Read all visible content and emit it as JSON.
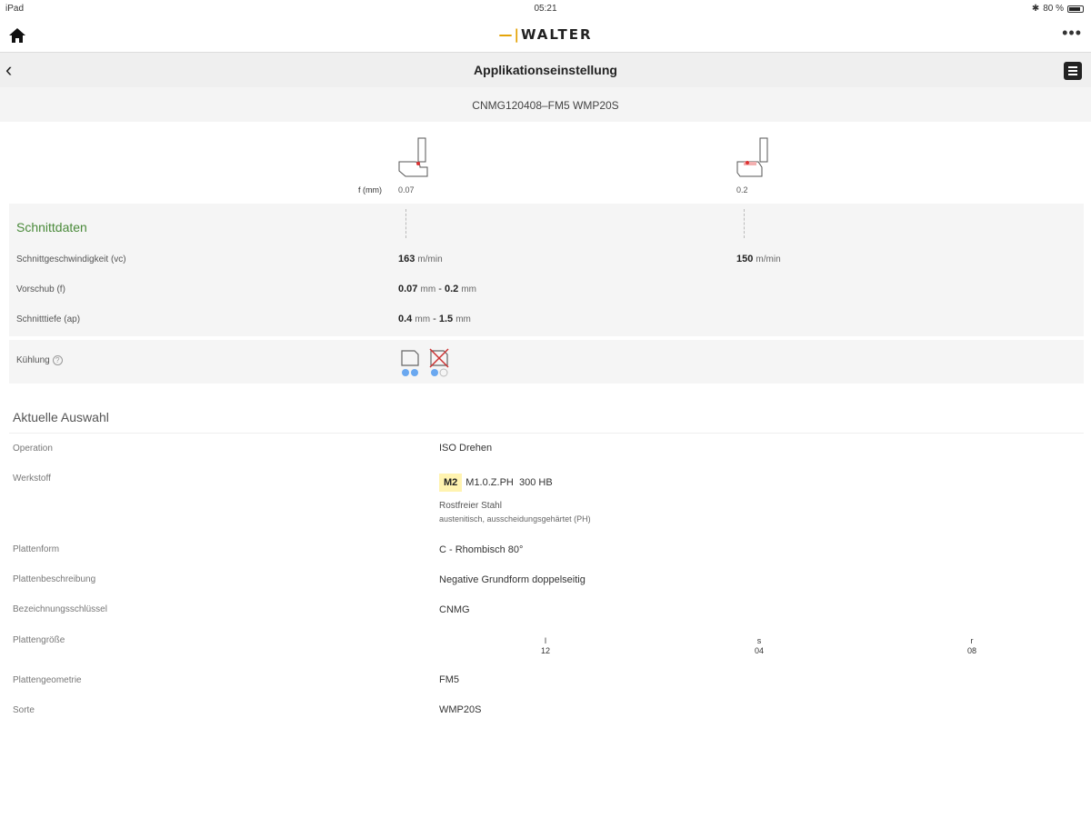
{
  "status": {
    "device": "iPad",
    "time": "05:21",
    "battery": "80 %"
  },
  "header": {
    "logo": "WALTER",
    "more": "•••"
  },
  "nav": {
    "title": "Applikationseinstellung"
  },
  "product": {
    "code": "CNMG120408–FM5 WMP20S"
  },
  "feed_header": {
    "label": "f (mm)",
    "values": [
      "0.07",
      "0.2"
    ]
  },
  "cutting": {
    "title": "Schnittdaten",
    "speed": {
      "label": "Schnittgeschwindigkeit (vc)",
      "v1": "163",
      "v2": "150",
      "unit": "m/min"
    },
    "feed": {
      "label": "Vorschub (f)",
      "from": "0.07",
      "to": "0.2",
      "unit": "mm",
      "sep": "-"
    },
    "depth": {
      "label": "Schnitttiefe (ap)",
      "from": "0.4",
      "to": "1.5",
      "unit": "mm",
      "sep": "-"
    },
    "cooling": {
      "label": "Kühlung",
      "help": "?"
    }
  },
  "selection": {
    "title": "Aktuelle Auswahl",
    "operation": {
      "label": "Operation",
      "value": "ISO Drehen"
    },
    "material": {
      "label": "Werkstoff",
      "badge": "M2",
      "code": "M1.0.Z.PH",
      "hardness": "300 HB",
      "name": "Rostfreier Stahl",
      "desc": "austenitisch, ausscheidungsgehärtet (PH)"
    },
    "shape": {
      "label": "Plattenform",
      "value": "C - Rhombisch 80°"
    },
    "description": {
      "label": "Plattenbeschreibung",
      "value": "Negative Grundform doppelseitig"
    },
    "key": {
      "label": "Bezeichnungsschlüssel",
      "value": "CNMG"
    },
    "size": {
      "label": "Plattengröße",
      "cols": [
        {
          "h": "l",
          "v": "12"
        },
        {
          "h": "s",
          "v": "04"
        },
        {
          "h": "r",
          "v": "08"
        }
      ]
    },
    "geometry": {
      "label": "Plattengeometrie",
      "value": "FM5"
    },
    "grade": {
      "label": "Sorte",
      "value": "WMP20S"
    }
  }
}
